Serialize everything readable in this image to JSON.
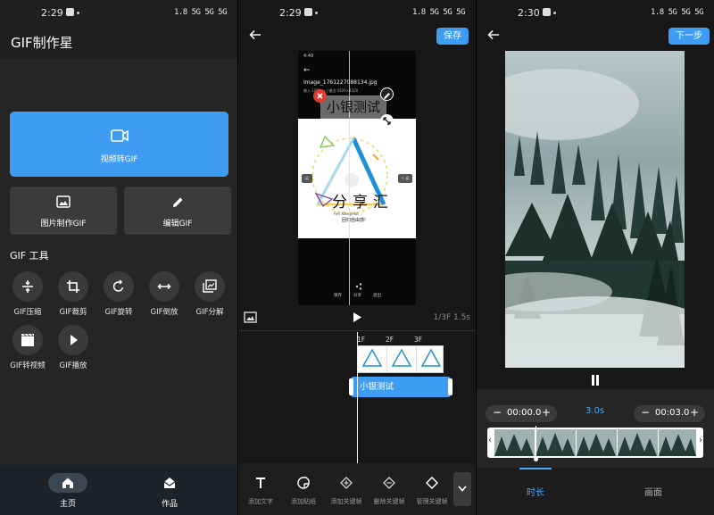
{
  "screen1": {
    "status": {
      "time": "2:29",
      "icons": "1.8 5G 5G 5G"
    },
    "app_title": "GIF制作星",
    "video_to_gif": "视频转GIF",
    "image_to_gif": "图片制作GIF",
    "edit_gif": "编辑GIF",
    "tools_title": "GIF 工具",
    "tools": [
      {
        "label": "GIF压缩",
        "icon": "compress-icon"
      },
      {
        "label": "GIF裁剪",
        "icon": "crop-icon"
      },
      {
        "label": "GIF旋转",
        "icon": "rotate-icon"
      },
      {
        "label": "GIF倒放",
        "icon": "reverse-icon"
      },
      {
        "label": "GIF分解",
        "icon": "split-icon"
      },
      {
        "label": "GIF转视频",
        "icon": "video-icon"
      },
      {
        "label": "GIF播放",
        "icon": "play-icon"
      }
    ],
    "nav": {
      "home": "主页",
      "works": "作品"
    },
    "colors": {
      "accent": "#3e9df2",
      "bg": "#1f1f1f"
    }
  },
  "screen2": {
    "status": {
      "time": "2:29",
      "icons": "1.8 5G 5G 5G"
    },
    "save": "保存",
    "preview": {
      "status_time": "4:49",
      "filename": "Image_1761227088134.jpg",
      "meta": "输入 1080px | 输出 4320×4320",
      "sticker_text": "小银测试",
      "art_title": "分享汇",
      "art_sub1": "Fen Xiang Hui",
      "art_sub2": "回归自由感!",
      "side_left": "返",
      "side_right": "< 返",
      "bottom": [
        "保存",
        "分享",
        "退出"
      ]
    },
    "frame_count": "1/3F 1.5s",
    "ruler": [
      "1F",
      "2F",
      "3F"
    ],
    "text_track": "小银测试",
    "toolbar": [
      {
        "label": "添加文字",
        "icon": "text-icon"
      },
      {
        "label": "添加贴纸",
        "icon": "sticker-icon"
      },
      {
        "label": "添加关键帧",
        "icon": "keyframe-add-icon"
      },
      {
        "label": "删除关键帧",
        "icon": "keyframe-remove-icon"
      },
      {
        "label": "管理关键帧",
        "icon": "keyframe-manage-icon"
      }
    ]
  },
  "screen3": {
    "status": {
      "time": "2:30",
      "icons": "1.8 5G 5G 5G"
    },
    "next": "下一步",
    "start_time": "00:00.0",
    "end_time": "00:03.0",
    "duration": "3.0s",
    "tabs": {
      "duration": "时长",
      "frame": "画面"
    },
    "active_tab": "duration"
  }
}
